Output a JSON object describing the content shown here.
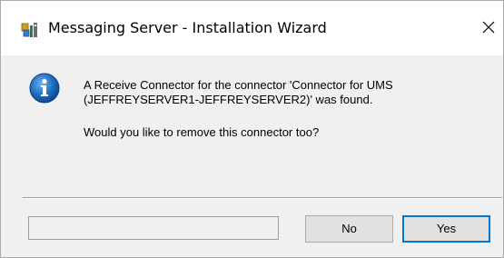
{
  "window": {
    "title": "Messaging Server - Installation Wizard",
    "title_icon": "setup-wizard-icon",
    "close_glyph": "×"
  },
  "dialog": {
    "icon": "info-icon",
    "message_line1": "A Receive Connector for the connector 'Connector for UMS",
    "message_line2": "(JEFFREYSERVER1-JEFFREYSERVER2)' was found.",
    "question": "Would you like to remove this connector too?",
    "status_text": ""
  },
  "buttons": {
    "no_label": "No",
    "yes_label": "Yes"
  },
  "colors": {
    "accent": "#0078d7",
    "info_blue": "#1e6fc1",
    "dialog_bg": "#f0f0f0"
  }
}
